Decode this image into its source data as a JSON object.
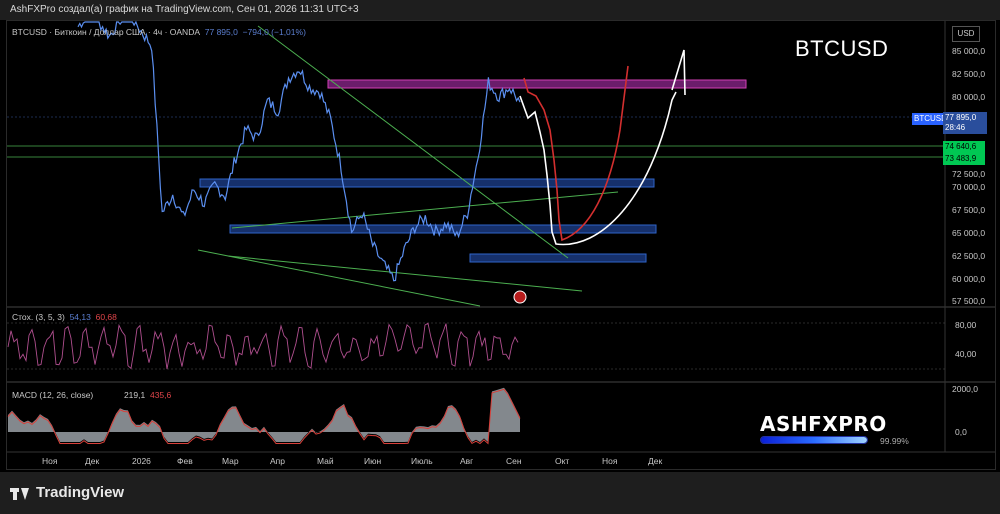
{
  "header": {
    "text": "AshFXPro создал(а) график на TradingView.com, Сен 01, 2026 11:31 UTC+3"
  },
  "legend": {
    "symbol": "BTCUSD · Биткоин / Доллар США · 4ч · OANDA",
    "value": "77 895,0",
    "change": "−794,0 (−1,01%)"
  },
  "title": "BTCUSD",
  "currency": "USD",
  "price_axis": {
    "ticks": [
      "85 000,0",
      "82 500,0",
      "80 000,0",
      "72 500,0",
      "70 000,0",
      "67 500,0",
      "65 000,0",
      "62 500,0",
      "60 000,0",
      "57 500,0"
    ],
    "symbol_tag": "BTCUSD",
    "current_price": "77 895,0",
    "countdown": "28:46",
    "level_1": "74 640,6",
    "level_2": "73 483,9"
  },
  "stoch": {
    "label": "Стох. (3, 5, 3)",
    "k": "54,13",
    "d": "60,68",
    "ticks": [
      "80,00",
      "40,00"
    ]
  },
  "macd": {
    "label": "MACD (12, 26, close)",
    "v1": "219,1",
    "v2": "435,6",
    "ticks": [
      "2000,0",
      "0,0"
    ]
  },
  "time_axis": [
    "Ноя",
    "Дек",
    "2026",
    "Фев",
    "Мар",
    "Апр",
    "Май",
    "Июн",
    "Июль",
    "Авг",
    "Сен",
    "Окт",
    "Ноя",
    "Дек"
  ],
  "branding": {
    "name": "ASHFXPRO",
    "progress_text": "99.99%",
    "progress": 0.9999
  },
  "footer": {
    "logo": "TradingView"
  },
  "colors": {
    "price_line": "#5b8ff0",
    "zone_blue": "#1e3a8a",
    "zone_magenta": "#c42fa3",
    "trend_green": "#4caf50",
    "stoch": "#b04f8f",
    "macd": "#9aa0a6",
    "macd_signal": "#d9403a"
  },
  "chart_data": {
    "type": "line",
    "price_range": [
      56000,
      86500
    ],
    "price_series_approx": [
      [
        0,
        86000
      ],
      [
        1,
        87500
      ],
      [
        2,
        86500
      ],
      [
        3,
        85000
      ],
      [
        4,
        86800
      ],
      [
        5,
        87200
      ],
      [
        6,
        85500
      ],
      [
        7,
        84000
      ],
      [
        8,
        66000
      ],
      [
        9,
        68000
      ],
      [
        10,
        65500
      ],
      [
        11,
        68500
      ],
      [
        12,
        67000
      ],
      [
        13,
        69000
      ],
      [
        14,
        67800
      ],
      [
        15,
        72000
      ],
      [
        16,
        75000
      ],
      [
        17,
        74000
      ],
      [
        18,
        78000
      ],
      [
        19,
        77000
      ],
      [
        20,
        80500
      ],
      [
        21,
        81500
      ],
      [
        22,
        79500
      ],
      [
        23,
        79000
      ],
      [
        24,
        76000
      ],
      [
        25,
        71000
      ],
      [
        26,
        64000
      ],
      [
        27,
        66000
      ],
      [
        28,
        62500
      ],
      [
        29,
        60500
      ],
      [
        30,
        58800
      ],
      [
        31,
        62000
      ],
      [
        32,
        64500
      ],
      [
        33,
        65500
      ],
      [
        34,
        64000
      ],
      [
        35,
        64800
      ],
      [
        36,
        63500
      ],
      [
        37,
        66000
      ],
      [
        38,
        72000
      ],
      [
        39,
        80000
      ],
      [
        40,
        78500
      ],
      [
        41,
        79500
      ],
      [
        42,
        77895
      ]
    ],
    "zones": [
      {
        "color": "magenta",
        "low": 80800,
        "high": 81800
      },
      {
        "color": "blue",
        "low": 70500,
        "high": 71400
      },
      {
        "color": "blue",
        "low": 65200,
        "high": 66000
      },
      {
        "color": "blue",
        "low": 62400,
        "high": 63200
      }
    ],
    "horizontal_levels": [
      74640.6,
      73483.9
    ]
  }
}
